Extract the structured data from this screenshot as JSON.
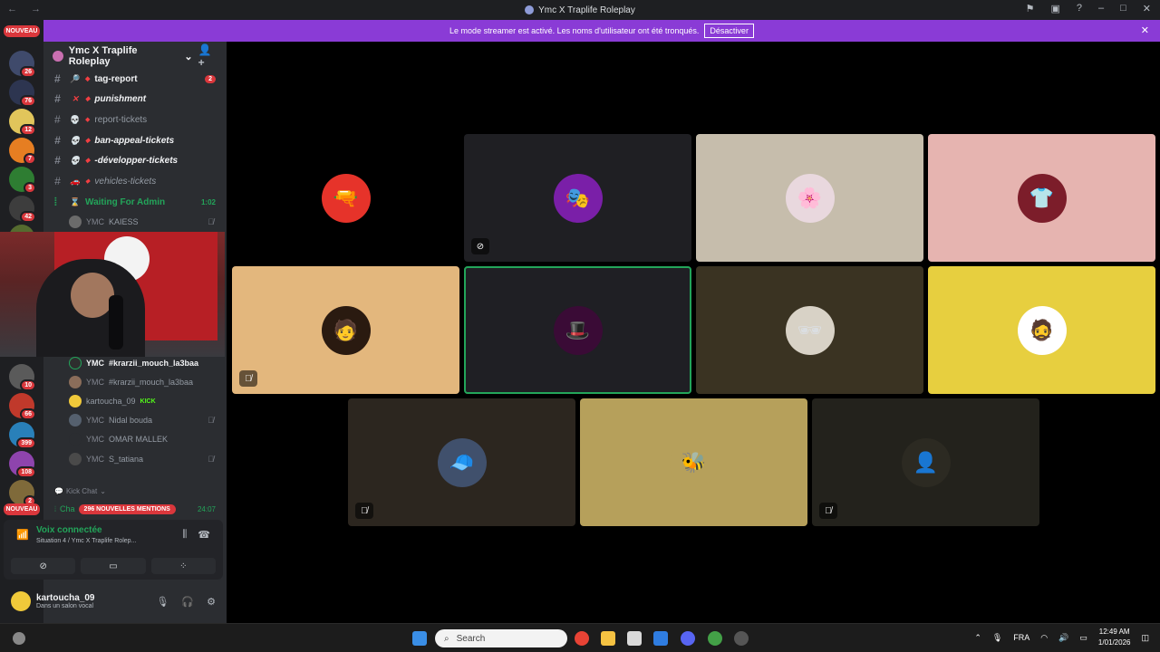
{
  "window": {
    "title": "Ymc X Traplife Roleplay",
    "nav": "← →"
  },
  "banner": {
    "text": "Le mode streamer est activé. Les noms d'utilisateur ont été tronqués.",
    "button": "Désactiver"
  },
  "servers": {
    "nouveau_top": "NOUVEAU",
    "nouveau_bottom": "NOUVEAU",
    "badges": [
      "26",
      "76",
      "12",
      "7",
      "3",
      "42",
      "122",
      "10",
      "66",
      "399",
      "108",
      "2"
    ]
  },
  "guild": {
    "name": "Ymc X Traplife Roleplay"
  },
  "channels": [
    {
      "name": "tag-report",
      "emoji": "🔎",
      "bold": true,
      "count": "2"
    },
    {
      "name": "punishment",
      "emoji": "✕",
      "bold": true
    },
    {
      "name": "report-tickets",
      "emoji": "💀",
      "bold": false
    },
    {
      "name": "ban-appeal-tickets",
      "emoji": "💀",
      "bold": true
    },
    {
      "name": "-développer-tickets",
      "emoji": "💀",
      "bold": true
    },
    {
      "name": "vehicles-tickets",
      "emoji": "🚗",
      "bold": false
    }
  ],
  "voice_channel": {
    "name": "Waiting For Admin",
    "time": "1:02"
  },
  "members_top": [
    {
      "tag": "YMC",
      "name": "KAIESS"
    }
  ],
  "members": [
    {
      "tag": "YMC",
      "name": "#krarzii_mouch_la3baa",
      "bold": true
    },
    {
      "tag": "YMC",
      "name": "#krarzii_mouch_la3baa",
      "bold": false
    },
    {
      "tag": "",
      "name": "kartoucha_09",
      "badge": "KICK"
    },
    {
      "tag": "YMC",
      "name": "Nidal bouda"
    },
    {
      "tag": "YMC",
      "name": "OMAR MALLEK"
    },
    {
      "tag": "YMC",
      "name": "S_tatiana"
    }
  ],
  "kick_chat": "Kick Chat",
  "mentions": {
    "channel": "Cha",
    "label": "296 NOUVELLES MENTIONS",
    "time": "24:07"
  },
  "voice_panel": {
    "status": "Voix connectée",
    "sub": "Situation 4 / Ymc X Traplife Rolep..."
  },
  "user": {
    "name": "kartoucha_09",
    "status": "Dans un salon vocal"
  },
  "taskbar": {
    "search": "Search",
    "lang": "FRA",
    "time": "12:49 AM",
    "date": "1/01/2026"
  },
  "tiles": [
    {
      "bg": "#000000",
      "avatar": "#e6332a",
      "glyph": "🔫"
    },
    {
      "bg": "#1f1f23",
      "avatar": "#7a1fa8",
      "glyph": "🎭",
      "muted": "deafened"
    },
    {
      "bg": "#c6bdac",
      "avatar": "#e9d8de",
      "glyph": "🌸"
    },
    {
      "bg": "#e6b4b0",
      "avatar": "#7c1d2a",
      "glyph": "👕"
    },
    {
      "bg": "#e3b77d",
      "avatar": "#2a1a10",
      "glyph": "🧑",
      "muted": "mic"
    },
    {
      "bg": "#1f1f24",
      "avatar": "#3a0b36",
      "glyph": "🎩",
      "speaking": true
    },
    {
      "bg": "#3a3322",
      "avatar": "#d8d2c6",
      "glyph": "🕶"
    },
    {
      "bg": "#e7cf3f",
      "avatar": "#ffffff",
      "glyph": "🧔"
    },
    {
      "bg": "#2c261f",
      "avatar": "#40506c",
      "glyph": "🧢",
      "muted": "mic"
    },
    {
      "bg": "#b6a05b",
      "avatar": "#b6a05b",
      "glyph": "🐝"
    },
    {
      "bg": "#23221c",
      "avatar": "#2c2a22",
      "glyph": "👤",
      "muted": "mic"
    }
  ]
}
